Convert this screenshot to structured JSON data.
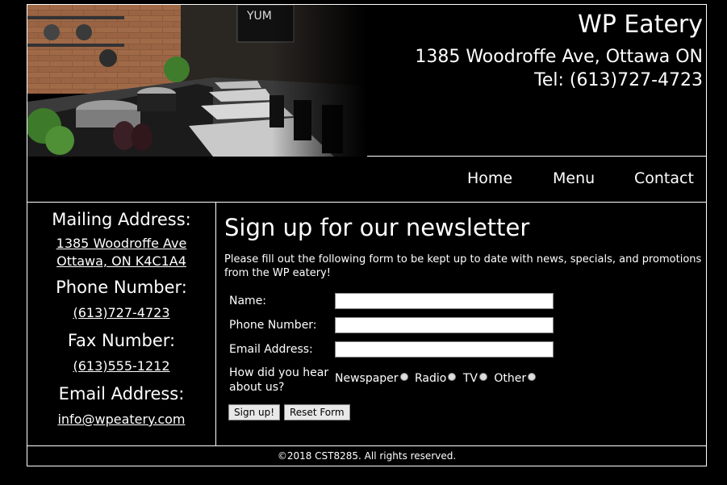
{
  "header": {
    "title": "WP Eatery",
    "address": "1385 Woodroffe Ave, Ottawa ON",
    "phone": "Tel: (613)727-4723",
    "hero_sign": "YUM"
  },
  "nav": {
    "items": [
      "Home",
      "Menu",
      "Contact"
    ]
  },
  "contact": {
    "mailing_label": "Mailing Address:",
    "mailing_line1": "1385 Woodroffe Ave",
    "mailing_line2": "Ottawa, ON K4C1A4",
    "phone_label": "Phone Number:",
    "phone_value": "(613)727-4723",
    "fax_label": "Fax Number:",
    "fax_value": "(613)555-1212",
    "email_label": "Email Address:",
    "email_value": "info@wpeatery.com"
  },
  "newsletter": {
    "title": "Sign up for our newsletter",
    "intro": "Please fill out the following form to be kept up to date with news, specials, and promotions from the WP eatery!",
    "name_label": "Name:",
    "name_value": "",
    "phone_label": "Phone Number:",
    "phone_value": "",
    "email_label": "Email Address:",
    "email_value": "",
    "hear_label_1": "How did you hear",
    "hear_label_2": "about us?",
    "options": [
      "Newspaper",
      "Radio",
      "TV",
      "Other"
    ],
    "signup_button": "Sign up!",
    "reset_button": "Reset Form"
  },
  "footer": {
    "text": "©2018 CST8285. All rights reserved."
  }
}
